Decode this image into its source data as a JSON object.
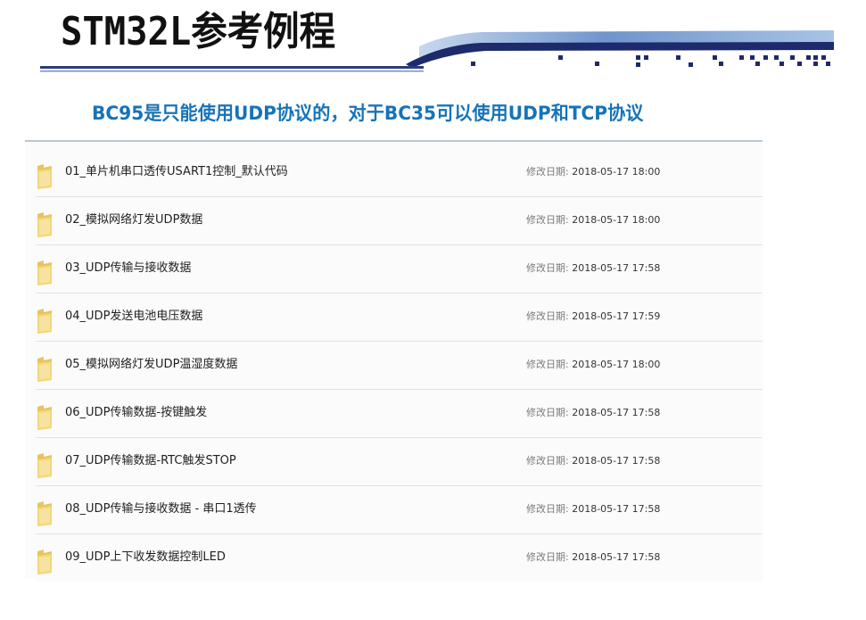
{
  "slide": {
    "title": "STM32L参考例程",
    "subtitle": "BC95是只能使用UDP协议的，对于BC35可以使用UDP和TCP协议"
  },
  "colors": {
    "title": "#111111",
    "subtitle": "#1673b8",
    "banner_dark": "#1d2a6b",
    "banner_light": "#8fb2dd"
  },
  "files": [
    {
      "name": "01_单片机串口透传USART1控制_默认代码",
      "date_label": "修改日期:",
      "date": "2018-05-17 18:00",
      "icon": "folder-icon"
    },
    {
      "name": "02_模拟网络灯发UDP数据",
      "date_label": "修改日期:",
      "date": "2018-05-17 18:00",
      "icon": "folder-icon"
    },
    {
      "name": "03_UDP传输与接收数据",
      "date_label": "修改日期:",
      "date": "2018-05-17 17:58",
      "icon": "folder-icon"
    },
    {
      "name": "04_UDP发送电池电压数据",
      "date_label": "修改日期:",
      "date": "2018-05-17 17:59",
      "icon": "folder-icon"
    },
    {
      "name": "05_模拟网络灯发UDP温湿度数据",
      "date_label": "修改日期:",
      "date": "2018-05-17 18:00",
      "icon": "folder-icon"
    },
    {
      "name": "06_UDP传输数据-按键触发",
      "date_label": "修改日期:",
      "date": "2018-05-17 17:58",
      "icon": "folder-icon"
    },
    {
      "name": "07_UDP传输数据-RTC触发STOP",
      "date_label": "修改日期:",
      "date": "2018-05-17 17:58",
      "icon": "folder-icon"
    },
    {
      "name": "08_UDP传输与接收数据 - 串口1透传",
      "date_label": "修改日期:",
      "date": "2018-05-17 17:58",
      "icon": "folder-icon"
    },
    {
      "name": "09_UDP上下收发数据控制LED",
      "date_label": "修改日期:",
      "date": "2018-05-17 17:58",
      "icon": "folder-icon"
    }
  ]
}
